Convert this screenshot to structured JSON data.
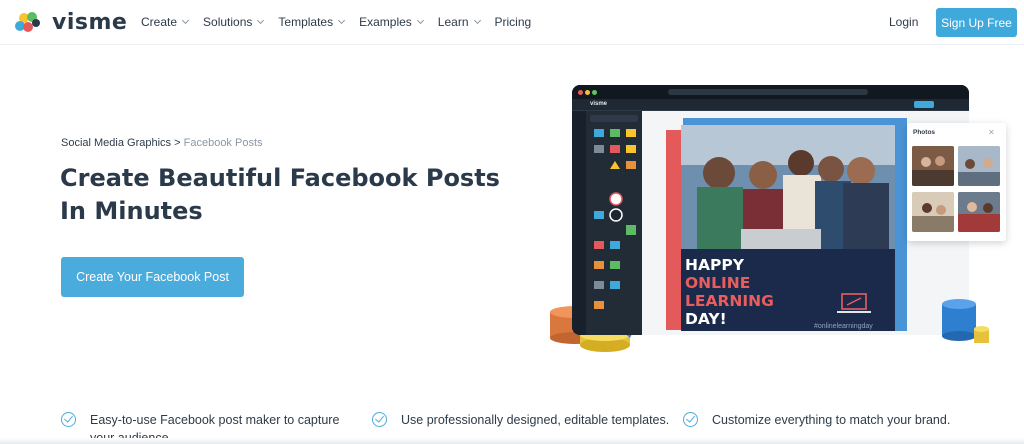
{
  "brand": {
    "name": "visme",
    "accent": "#3fa9dc",
    "text": "#2b3a4a"
  },
  "nav": {
    "items": [
      {
        "label": "Create",
        "has_dropdown": true
      },
      {
        "label": "Solutions",
        "has_dropdown": true
      },
      {
        "label": "Templates",
        "has_dropdown": true
      },
      {
        "label": "Examples",
        "has_dropdown": true
      },
      {
        "label": "Learn",
        "has_dropdown": true
      },
      {
        "label": "Pricing",
        "has_dropdown": false
      }
    ],
    "login": "Login",
    "signup": "Sign Up Free"
  },
  "hero": {
    "breadcrumb": {
      "parent": "Social Media Graphics",
      "separator": ">",
      "current": "Facebook Posts"
    },
    "headline_line1": "Create Beautiful Facebook Posts",
    "headline_line2": "In Minutes",
    "cta": "Create Your Facebook Post"
  },
  "mockup": {
    "app_logo": "visme",
    "poster": {
      "line1": "HAPPY",
      "line2": "ONLINE",
      "line3": "LEARNING",
      "line4": "DAY!",
      "hashtag": "#onlinelearningday"
    },
    "photos_panel_title": "Photos"
  },
  "features": [
    {
      "line1": "Easy-to-use Facebook post maker to capture",
      "line2": "your audience."
    },
    {
      "line1": "Use professionally designed, editable templates.",
      "line2": ""
    },
    {
      "line1": "Customize everything to match your brand.",
      "line2": ""
    }
  ]
}
